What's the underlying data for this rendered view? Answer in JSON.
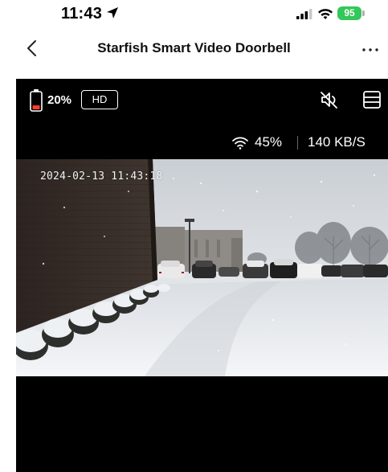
{
  "status_bar": {
    "time": "11:43",
    "battery_percent": "95"
  },
  "nav": {
    "title": "Starfish Smart Video Doorbell",
    "back_icon": "chevron-left-icon",
    "more_icon": "more-horizontal-icon"
  },
  "live": {
    "device_battery": "20%",
    "quality_label": "HD",
    "wifi_strength": "45%",
    "bitrate": "140 KB/S",
    "timestamp": "2024-02-13 11:43:18",
    "mute_icon": "speaker-muted-icon",
    "layout_icon": "split-view-icon"
  },
  "colors": {
    "battery_green": "#34c759",
    "battery_low": "#ff3b30",
    "panel_bg": "#000000"
  }
}
